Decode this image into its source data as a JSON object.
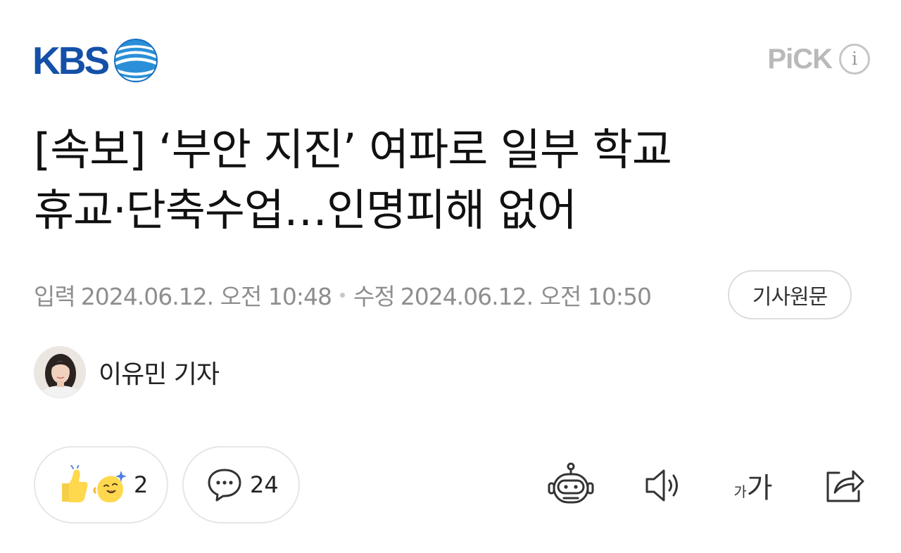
{
  "header": {
    "brand": "KBS",
    "pick": "PiCK",
    "info_icon": "i"
  },
  "headline": {
    "line1": "[속보] ‘부안 지진’ 여파로 일부 학교",
    "line2": "휴교·단축수업…인명피해 없어"
  },
  "meta": {
    "input_label": "입력",
    "input_datetime": "2024.06.12. 오전 10:48",
    "modified_label": "수정",
    "modified_datetime": "2024.06.12. 오전 10:50",
    "original_article_button": "기사원문"
  },
  "reporter": {
    "name": "이유민 기자"
  },
  "actions": {
    "reaction_count": "2",
    "comment_count": "24",
    "font_size_small": "가",
    "font_size_large": "가"
  },
  "colors": {
    "brand_blue": "#1450a8",
    "meta_gray": "#8e8e8e",
    "border_gray": "#e6e6e6"
  },
  "icons": [
    "kbs-globe-icon",
    "info-icon",
    "thumbs-up-icon",
    "cheer-face-icon",
    "comment-icon",
    "robot-summary-icon",
    "speaker-icon",
    "font-size-icon",
    "share-icon"
  ]
}
